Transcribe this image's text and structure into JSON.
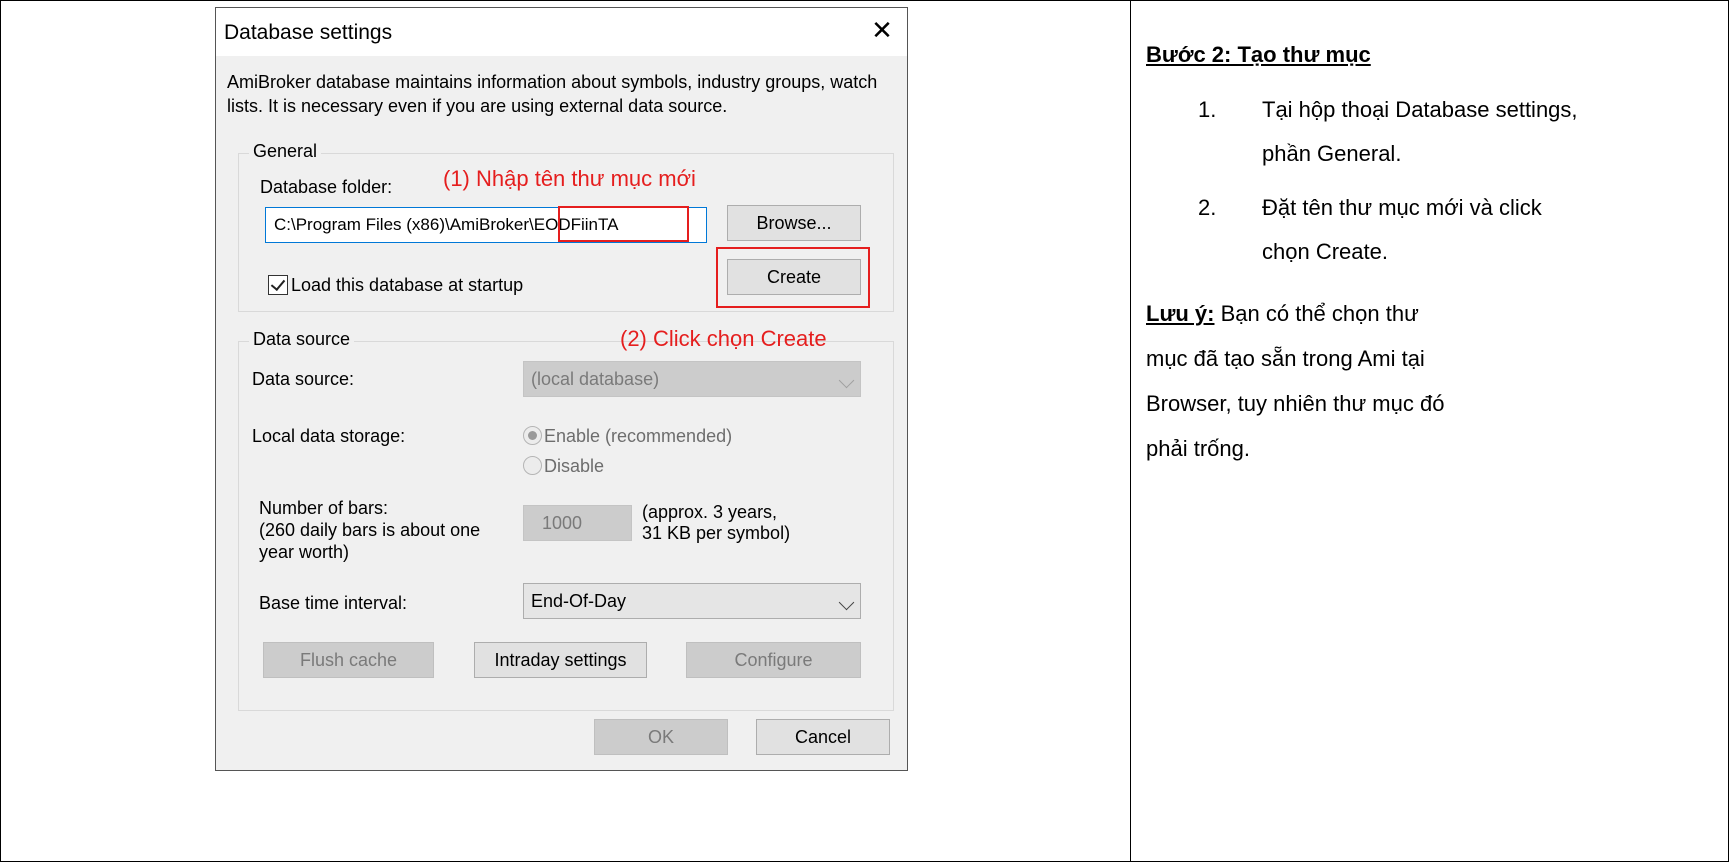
{
  "dialog": {
    "title": "Database settings",
    "close_glyph": "✕",
    "intro": "AmiBroker database maintains information about symbols, industry groups, watch lists. It is necessary even if you are using external data source.",
    "general": {
      "label": "General",
      "folder_label": "Database folder:",
      "folder_value": "C:\\Program Files (x86)\\AmiBroker\\EODFiinTA",
      "browse": "Browse...",
      "create": "Create",
      "load_at_startup": "Load this database at startup",
      "load_checked": true
    },
    "data_source": {
      "label": "Data source",
      "source_label": "Data source:",
      "source_value": "(local database)",
      "storage_label": "Local data storage:",
      "enable": "Enable (recommended)",
      "disable": "Disable",
      "bars_label_1": "Number of bars:",
      "bars_label_2": "(260 daily bars is about one",
      "bars_label_3": "year worth)",
      "bars_value": "1000",
      "bars_note_1": "(approx. 3 years,",
      "bars_note_2": "31 KB per symbol)",
      "interval_label": "Base time interval:",
      "interval_value": "End-Of-Day",
      "flush_cache": "Flush cache",
      "intraday_settings": "Intraday settings",
      "configure": "Configure"
    },
    "ok": "OK",
    "cancel": "Cancel"
  },
  "annotations": {
    "step1": "(1) Nhập tên thư mục mới",
    "step2": "(2) Click chọn Create"
  },
  "instructions": {
    "title": "Bước 2: Tạo thư mục",
    "steps": [
      {
        "num": "1.",
        "text": "Tại hộp thoại Database settings, phần General."
      },
      {
        "num": "2.",
        "text": "Đặt tên thư mục mới và click chọn Create."
      }
    ],
    "note_label": "Lưu ý:",
    "note_text": " Bạn có thể chọn thư mục đã tạo sẵn trong Ami tại Browser, tuy nhiên thư mục đó phải trống."
  },
  "colors": {
    "annotation_red": "#e51e1e",
    "dialog_bg": "#f0f0f0",
    "focus_blue": "#0078d7"
  }
}
